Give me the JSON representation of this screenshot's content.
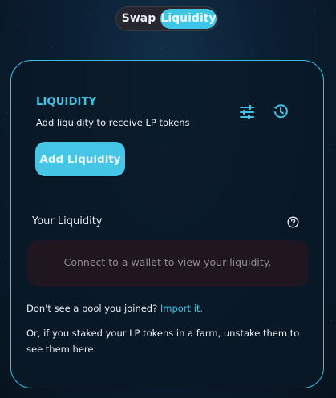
{
  "toggle": {
    "swap_label": "Swap",
    "liquidity_label": "Liquidity",
    "active": "Liquidity"
  },
  "card": {
    "title": "LIQUIDITY",
    "subtitle": "Add liquidity to receive LP tokens",
    "add_button_label": "Add Liquidity",
    "your_liquidity_label": "Your Liquidity",
    "empty_message": "Connect to a wallet to view your liquidity.",
    "dont_see_text": "Don't see a pool you joined?",
    "import_link_text": "Import it.",
    "staked_note": "Or, if you staked your LP tokens in a farm, unstake them to see them here."
  },
  "icons": {
    "settings": "sliders-icon",
    "history": "history-clock-icon",
    "help": "question-circle-icon"
  },
  "colors": {
    "accent": "#3fc6e6",
    "background": "#0b1e32",
    "card_border": "#3cbde6",
    "empty_box": "#1f1620",
    "muted_text": "#8f8c96"
  }
}
